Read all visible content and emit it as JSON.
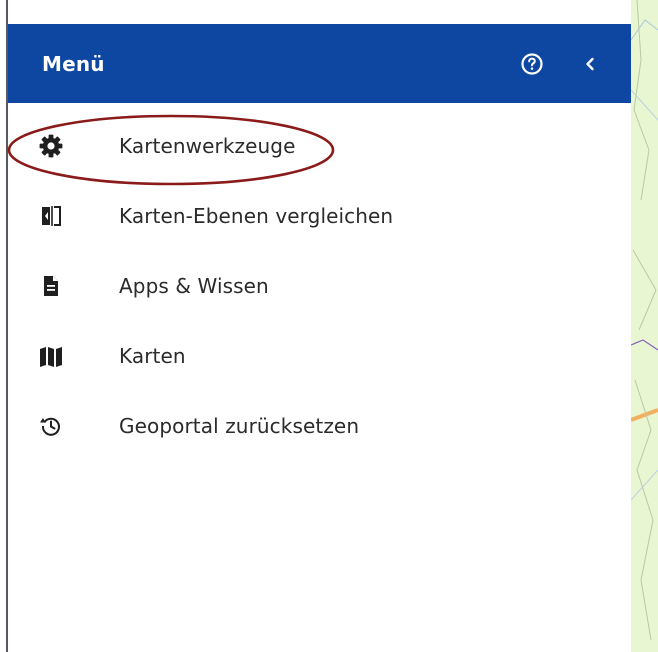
{
  "header": {
    "title": "Menü",
    "help_icon": "help-circle-icon",
    "collapse_icon": "chevron-left-icon",
    "background_color": "#0d47a1"
  },
  "menu": {
    "items": [
      {
        "label": "Kartenwerkzeuge",
        "icon": "gear-icon"
      },
      {
        "label": "Karten-Ebenen vergleichen",
        "icon": "compare-layers-icon"
      },
      {
        "label": "Apps & Wissen",
        "icon": "document-icon"
      },
      {
        "label": "Karten",
        "icon": "map-icon"
      },
      {
        "label": "Geoportal zurücksetzen",
        "icon": "history-reset-icon"
      }
    ]
  },
  "annotation": {
    "color": "#8b1a1a",
    "target": "Kartenwerkzeuge"
  }
}
